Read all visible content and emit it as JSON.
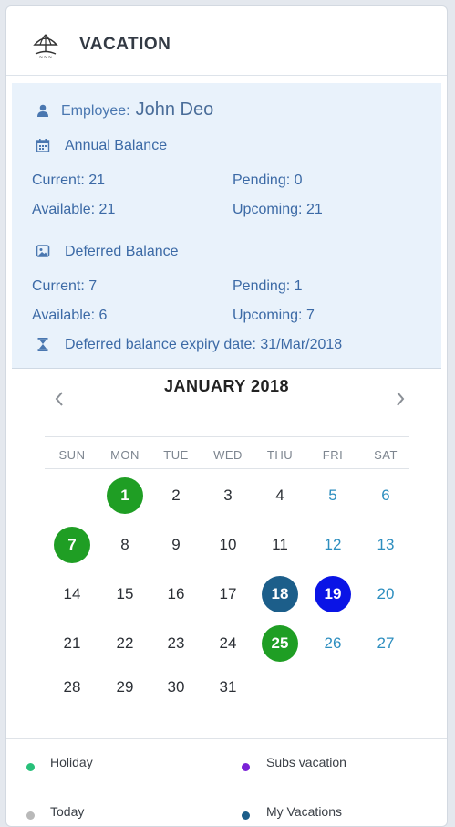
{
  "header": {
    "title": "VACATION",
    "icon": "umbrella-globe-icon"
  },
  "info": {
    "employee_label": "Employee:",
    "employee_name": "John Deo",
    "annual_title": "Annual Balance",
    "annual": {
      "current_label": "Current:",
      "current": "21",
      "pending_label": "Pending:",
      "pending": "0",
      "available_label": "Available:",
      "available": "21",
      "upcoming_label": "Upcoming:",
      "upcoming": "21"
    },
    "deferred_title": "Deferred Balance",
    "deferred": {
      "current_label": "Current:",
      "current": "7",
      "pending_label": "Pending:",
      "pending": "1",
      "available_label": "Available:",
      "available": "6",
      "upcoming_label": "Upcoming:",
      "upcoming": "7"
    },
    "expiry_label": "Deferred balance expiry date:",
    "expiry_value": "31/Mar/2018"
  },
  "calendar": {
    "title": "JANUARY 2018",
    "weekdays": [
      "SUN",
      "MON",
      "TUE",
      "WED",
      "THU",
      "FRI",
      "SAT"
    ],
    "first_weekday_index": 1,
    "days_in_month": 31,
    "holidays": [
      1,
      7,
      25
    ],
    "my_vacations": [
      18
    ],
    "subs_vacations": [
      19
    ]
  },
  "legend": {
    "holiday": "Holiday",
    "subs_vacation": "Subs vacation",
    "today": "Today",
    "my_vacations": "My Vacations"
  },
  "colors": {
    "holiday": "#1f9e24",
    "my_vacation": "#1c5e8a",
    "subs_vacation": "#0a14e6",
    "weekend_text": "#2d8ebf",
    "legend_holiday": "#28c07a",
    "legend_subs": "#7a22d6",
    "legend_today": "#b9b9b9",
    "legend_myvac": "#1c5e8a"
  }
}
